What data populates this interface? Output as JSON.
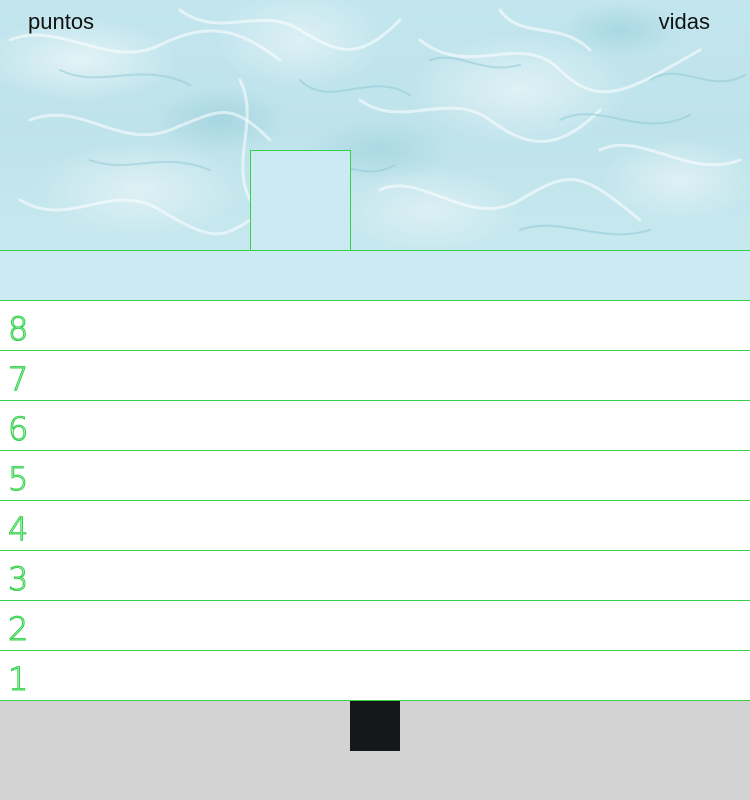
{
  "hud": {
    "score_label": "puntos",
    "lives_label": "vidas"
  },
  "rows": [
    {
      "label": "8"
    },
    {
      "label": "7"
    },
    {
      "label": "6"
    },
    {
      "label": "5"
    },
    {
      "label": "4"
    },
    {
      "label": "3"
    },
    {
      "label": "2"
    },
    {
      "label": "1"
    }
  ],
  "colors": {
    "grid_line": "#33d24a",
    "row_number": "#33d24a",
    "drop_row": "#cceaf2",
    "tray": "#d3d3d3",
    "player": "#161719"
  }
}
